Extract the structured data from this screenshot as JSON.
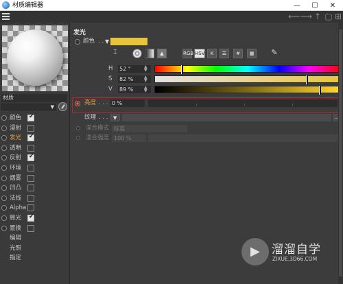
{
  "window": {
    "title": "材质编辑器",
    "min": "—",
    "max": "☐",
    "close": "✕"
  },
  "left": {
    "material_name": "材质",
    "channels": [
      {
        "label": "颜色",
        "state": "on"
      },
      {
        "label": "漫射",
        "state": "off"
      },
      {
        "label": "发光",
        "state": "on",
        "active": true
      },
      {
        "label": "透明",
        "state": "off"
      },
      {
        "label": "反射",
        "state": "on"
      },
      {
        "label": "环境",
        "state": "off"
      },
      {
        "label": "烟雾",
        "state": "off"
      },
      {
        "label": "凹凸",
        "state": "off"
      },
      {
        "label": "法线",
        "state": "off"
      },
      {
        "label": "Alpha",
        "state": "off"
      },
      {
        "label": "辉光",
        "state": "on"
      },
      {
        "label": "置换",
        "state": "off"
      }
    ],
    "extra": [
      "编辑",
      "光照",
      "指定"
    ]
  },
  "main": {
    "section": "发光",
    "color_label": "颜色",
    "color_dots": ". .",
    "color_swatch": "#e8c43a",
    "tools": [
      "RGB",
      "HSV",
      "K",
      "☰",
      "#",
      "▦"
    ],
    "hsv": [
      {
        "name": "H",
        "value": "52 °",
        "knob": 0.14
      },
      {
        "name": "S",
        "value": "82 %",
        "knob": 0.82
      },
      {
        "name": "V",
        "value": "89 %",
        "knob": 0.89
      }
    ],
    "brightness_label": "亮度",
    "brightness_dots": ". . .",
    "brightness_value": "0 %",
    "texture_label": "纹理",
    "texture_dots": ". . .",
    "texture_more": "...",
    "blend_mode_label": "混合模式",
    "blend_mode_value": "标准",
    "blend_strength_label": "混合强度",
    "blend_strength_value": "100 %"
  },
  "watermark": {
    "title": "溜溜自学",
    "url": "ZIXUE.3D66.COM"
  }
}
